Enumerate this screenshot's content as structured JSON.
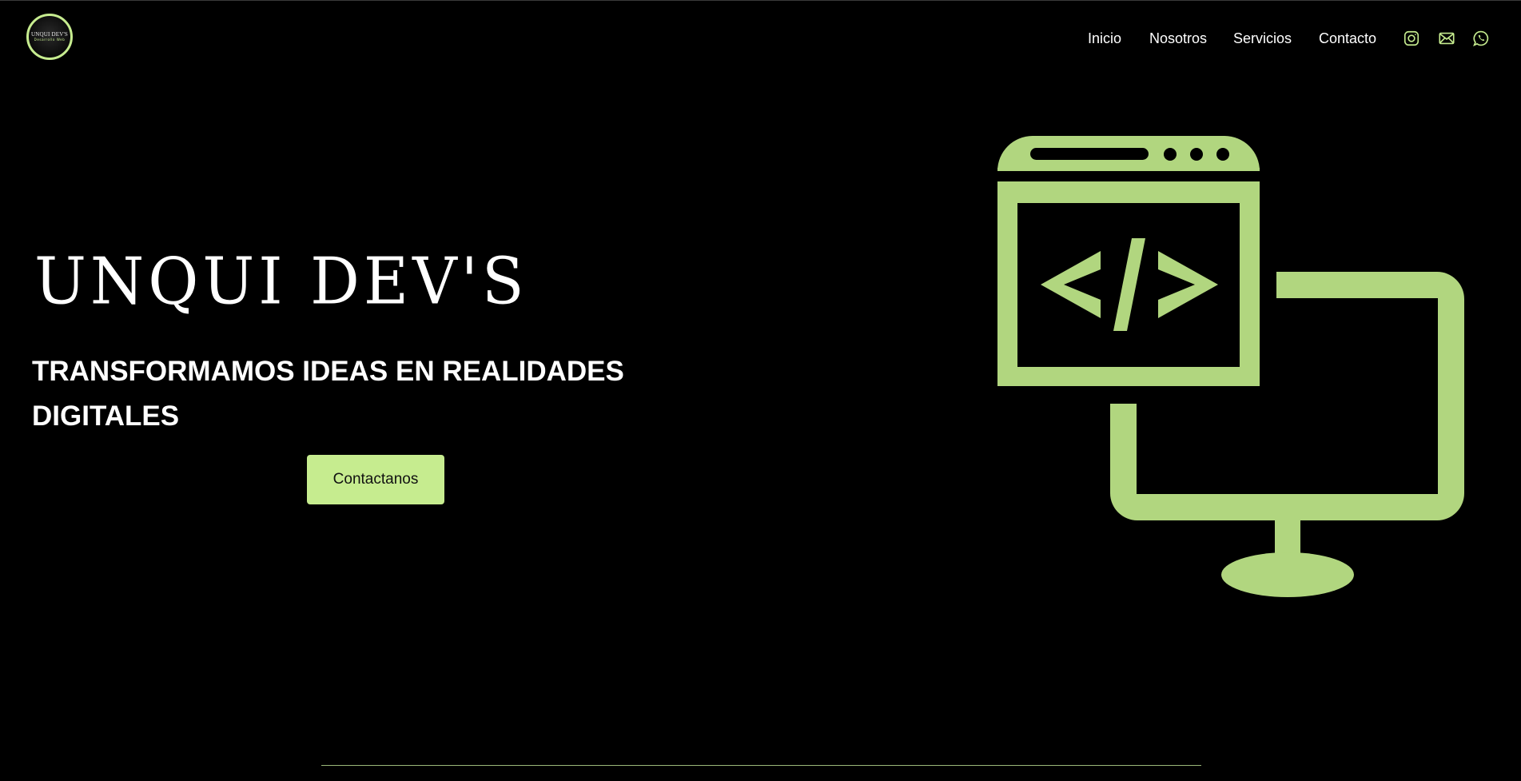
{
  "brand": {
    "logo_title": "UNQUI DEV'S",
    "logo_subtitle": "Desarrollo Web",
    "accent_color": "#c6ec8f",
    "illustration_color": "#b1d67f",
    "background_color": "#000000"
  },
  "nav": {
    "items": [
      {
        "label": "Inicio"
      },
      {
        "label": "Nosotros"
      },
      {
        "label": "Servicios"
      },
      {
        "label": "Contacto"
      }
    ],
    "social": [
      {
        "icon": "instagram-icon"
      },
      {
        "icon": "mail-icon"
      },
      {
        "icon": "whatsapp-icon"
      }
    ]
  },
  "hero": {
    "title": "UNQUI DEV'S",
    "subtitle": "TRANSFORMAMOS IDEAS EN REALIDADES DIGITALES",
    "cta_label": "Contactanos",
    "illustration_icon": "web-development-code-icon"
  }
}
